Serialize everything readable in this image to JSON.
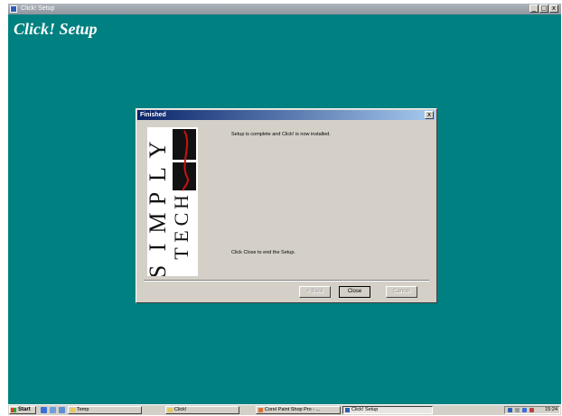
{
  "window": {
    "title": "Click! Setup",
    "heading": "Click! Setup",
    "controls": {
      "minimize": "_",
      "maximize": "□",
      "close": "x"
    }
  },
  "dialog": {
    "title": "Finished",
    "close_glyph": "x",
    "brand": {
      "left_letters": [
        "S",
        "I",
        "M",
        "P",
        "L",
        "Y"
      ],
      "right_letters": [
        "T",
        "E",
        "C",
        "H"
      ]
    },
    "finish_message": "Setup is complete and Click! is now installed.",
    "close_hint": "Click Close to end the Setup.",
    "buttons": {
      "back": "< Back",
      "close": "Close",
      "cancel": "Cancel"
    }
  },
  "taskbar": {
    "start": "Start",
    "tasks": [
      {
        "label": "Temp"
      },
      {
        "label": "Click!"
      },
      {
        "label": "Corel Paint Shop Pro - ..."
      },
      {
        "label": "Click! Setup",
        "active": true
      }
    ],
    "clock": "15:24"
  },
  "colors": {
    "desktop": "#008080",
    "dialog_face": "#d4d0c8",
    "titlebar_active": "#0a246a",
    "brand_accent": "#cc1111"
  }
}
